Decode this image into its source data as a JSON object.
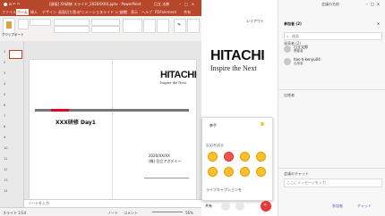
{
  "ppt": {
    "title": "[部長] XX研修 スライド_2020XXXX.pptx - PowerPoint",
    "user_label": "日立 太郎",
    "tabs": [
      "ファイル",
      "ホーム",
      "挿入",
      "デザイン",
      "画面切り替え",
      "アニメーション",
      "スライド ショー",
      "校閲",
      "表示",
      "ヘルプ",
      "PDFelement",
      "共有"
    ],
    "active_tab_index": 1,
    "paste_label": "貼り付け",
    "clipboard_label": "クリップボード",
    "slide_nums": [
      "1",
      "2",
      "3",
      "4",
      "5",
      "6",
      "7",
      "8",
      "9",
      "10",
      "11",
      "12",
      "13",
      "14"
    ],
    "slide": {
      "logo": "HITACHI",
      "tagline": "Inspire the Next",
      "heading": "XXX研修 Day1",
      "date": "2020/XX/XX",
      "presenter": "(株) 日立アカデミー",
      "accent_color": "#e60027"
    },
    "notes_placeholder": "ノートを入力",
    "status": {
      "slide_info": "スライド 1/14",
      "notes": "ノート",
      "comments": "コメント",
      "zoom": "56%"
    }
  },
  "stage": {
    "layout_label": "レイアウト",
    "logo": "HITACHI",
    "tagline": "Inspire the Next"
  },
  "reactions": {
    "raise_hand_label": "挙手",
    "section_label": "反応を送る",
    "emojis": [
      "thumbs-up",
      "heart",
      "clap",
      "laugh",
      "surprised",
      "thinking-face",
      "sad",
      "thumbs-down"
    ],
    "live_caption_label": "ライブキャプションを"
  },
  "controls": {
    "share_label": "共有"
  },
  "participants": {
    "title": "参加者 (2)",
    "search_placeholder": "検索",
    "invite_label": "",
    "section_label": "発表者 (2)",
    "people": [
      {
        "name": "日立太郎",
        "role": "開催者"
      },
      {
        "name": "hac-h-kenyu04",
        "role": "出席者"
      }
    ],
    "bottom_section": "出席者"
  },
  "chat": {
    "title": "会議のチャット",
    "input_placeholder": "ここにメッセージを入力",
    "buttons": [
      "参加者",
      "チャット"
    ]
  },
  "window": {
    "title": "会議の名前"
  }
}
